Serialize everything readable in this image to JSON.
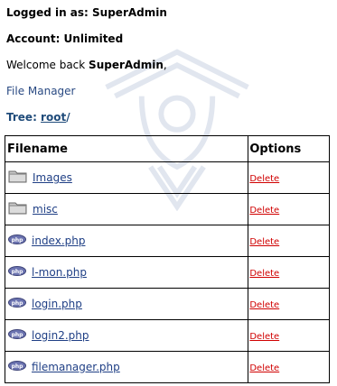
{
  "header": {
    "logged_in_label": "Logged in as: SuperAdmin",
    "account_label": "Account: Unlimited",
    "welcome_prefix": "Welcome back ",
    "welcome_user": "SuperAdmin",
    "welcome_suffix": ","
  },
  "nav": {
    "file_manager_label": "File Manager",
    "tree_label": "Tree: ",
    "tree_root": "root",
    "tree_sep": "/"
  },
  "table": {
    "headers": [
      "Filename",
      "Options"
    ],
    "rows": [
      {
        "name": "Images",
        "type": "folder",
        "icon": "folder-icon",
        "action": "Delete"
      },
      {
        "name": "misc",
        "type": "folder",
        "icon": "folder-icon",
        "action": "Delete"
      },
      {
        "name": "index.php",
        "type": "php",
        "icon": "php-file-icon",
        "action": "Delete"
      },
      {
        "name": "l-mon.php",
        "type": "php",
        "icon": "php-file-icon",
        "action": "Delete"
      },
      {
        "name": "login.php",
        "type": "php",
        "icon": "php-file-icon",
        "action": "Delete"
      },
      {
        "name": "login2.php",
        "type": "php",
        "icon": "php-file-icon",
        "action": "Delete"
      },
      {
        "name": "filemanager.php",
        "type": "php",
        "icon": "php-file-icon",
        "action": "Delete"
      }
    ]
  },
  "colors": {
    "link": "#1f3f85",
    "delete": "#d00000",
    "tree": "#1f4b7a"
  }
}
